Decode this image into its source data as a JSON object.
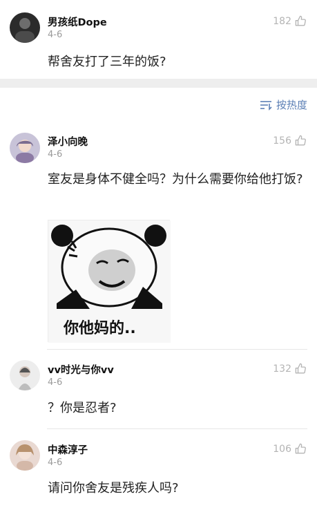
{
  "post": {
    "author": "男孩纸Dope",
    "date": "4-6",
    "likes": "182",
    "text": "帮舍友打了三年的饭?"
  },
  "sort": {
    "label": "按热度"
  },
  "comments": [
    {
      "author": "泽小向晚",
      "date": "4-6",
      "likes": "156",
      "text": "室友是身体不健全吗？为什么需要你给他打饭?",
      "meme_caption": "你他妈的.."
    },
    {
      "author": "vv时光与你vv",
      "date": "4-6",
      "likes": "132",
      "text": "？你是忍者?"
    },
    {
      "author": "中森淳子",
      "date": "4-6",
      "likes": "106",
      "text": "请问你舍友是残疾人吗?"
    }
  ],
  "icons": {
    "like": "thumbs-up-icon",
    "sort": "sort-lines-icon"
  },
  "colors": {
    "accent": "#5b7fb5",
    "muted": "#9a9a9a",
    "divider": "#e6e6e6",
    "separator": "#eeeeee"
  }
}
